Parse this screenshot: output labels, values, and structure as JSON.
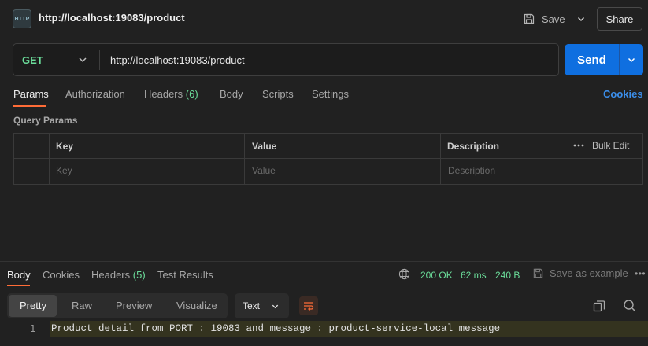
{
  "header": {
    "icon_text": "HTTP",
    "title": "http://localhost:19083/product",
    "save_label": "Save",
    "share_label": "Share"
  },
  "request": {
    "method": "GET",
    "url": "http://localhost:19083/product",
    "send_label": "Send"
  },
  "tabs": {
    "params": "Params",
    "authorization": "Authorization",
    "headers": "Headers",
    "headers_count": "(6)",
    "body": "Body",
    "scripts": "Scripts",
    "settings": "Settings",
    "cookies": "Cookies"
  },
  "query_params": {
    "label": "Query Params",
    "columns": {
      "key": "Key",
      "value": "Value",
      "description": "Description"
    },
    "bulk_edit": "Bulk Edit",
    "placeholders": {
      "key": "Key",
      "value": "Value",
      "description": "Description"
    }
  },
  "response": {
    "tabs": {
      "body": "Body",
      "cookies": "Cookies",
      "headers": "Headers",
      "headers_count": "(5)",
      "test_results": "Test Results"
    },
    "status": "200 OK",
    "time": "62 ms",
    "size": "240 B",
    "save_example": "Save as example",
    "views": [
      "Pretty",
      "Raw",
      "Preview",
      "Visualize"
    ],
    "format": "Text",
    "lines": [
      {
        "number": "1",
        "text": "Product detail from PORT : 19083 and message : product-service-local message"
      }
    ]
  },
  "colors": {
    "accent_orange": "#ff6c37",
    "send_blue": "#0f6fe0",
    "status_green": "#6bdd9a",
    "link_blue": "#3b8eea"
  }
}
